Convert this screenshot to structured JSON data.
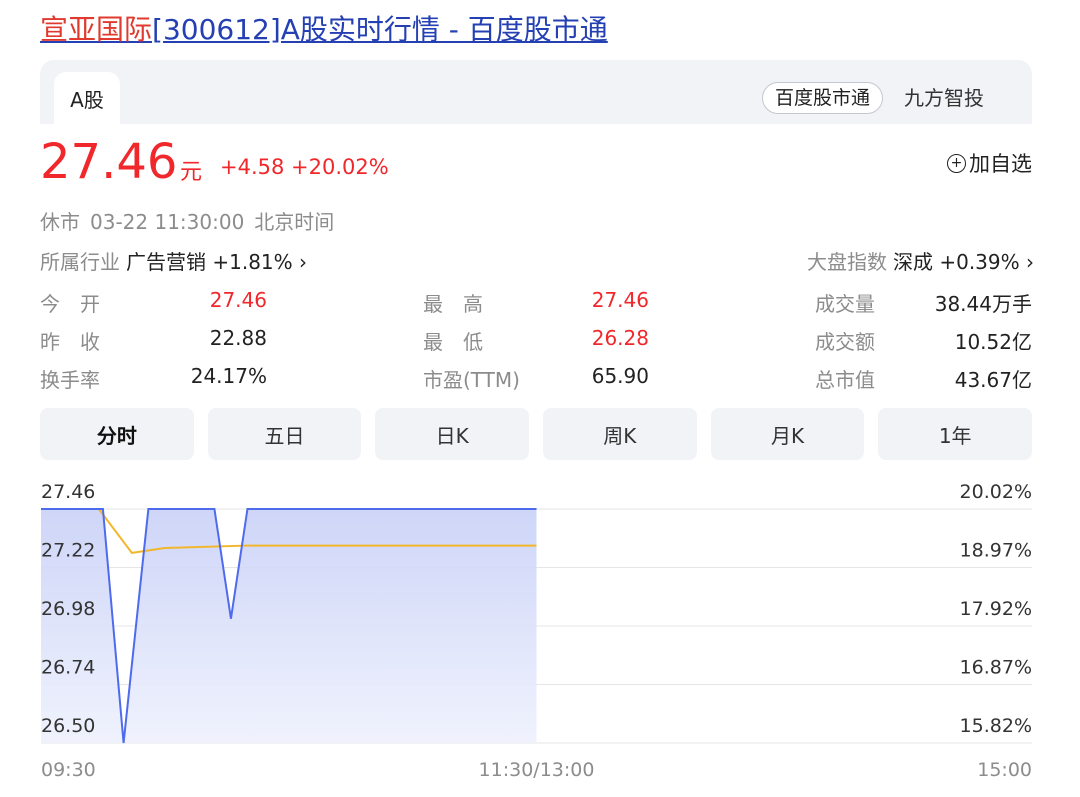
{
  "page": {
    "title_hl": "宣亚国际",
    "title_rest": "[300612]A股实时行情 - 百度股市通"
  },
  "tabs": {
    "active": "A股",
    "source_pill": "百度股市通",
    "source_other": "九方智投"
  },
  "quote": {
    "price": "27.46",
    "unit": "元",
    "change": "+4.58 +20.02%",
    "add_watch": "加自选",
    "status": "休市",
    "datetime": "03-22 11:30:00",
    "timezone": "北京时间",
    "industry_label": "所属行业",
    "industry_name": "广告营销",
    "industry_change": "+1.81% ›",
    "index_label": "大盘指数",
    "index_name": "深成",
    "index_change": "+0.39% ›"
  },
  "stats": [
    [
      {
        "label": "今　开",
        "value": "27.46",
        "color": "red"
      },
      {
        "label": "最　高",
        "value": "27.46",
        "color": "red"
      },
      {
        "label": "成交量",
        "value": "38.44万手",
        "color": "black"
      }
    ],
    [
      {
        "label": "昨　收",
        "value": "22.88",
        "color": "black"
      },
      {
        "label": "最　低",
        "value": "26.28",
        "color": "red"
      },
      {
        "label": "成交额",
        "value": "10.52亿",
        "color": "black"
      }
    ],
    [
      {
        "label": "换手率",
        "value": "24.17%",
        "color": "black"
      },
      {
        "label": "市盈(TTM)",
        "value": "65.90",
        "color": "black"
      },
      {
        "label": "总市值",
        "value": "43.67亿",
        "color": "black"
      }
    ]
  ],
  "timeframes": [
    {
      "label": "分时",
      "active": true
    },
    {
      "label": "五日",
      "active": false
    },
    {
      "label": "日K",
      "active": false
    },
    {
      "label": "周K",
      "active": false
    },
    {
      "label": "月K",
      "active": false
    },
    {
      "label": "1年",
      "active": false
    }
  ],
  "chart_data": {
    "type": "line",
    "y_ticks": [
      "27.46",
      "27.22",
      "26.98",
      "26.74",
      "26.50"
    ],
    "pct_ticks": [
      "20.02%",
      "18.97%",
      "17.92%",
      "16.87%",
      "15.82%"
    ],
    "x_ticks": [
      "09:30",
      "11:30/13:00",
      "15:00"
    ],
    "ylim": [
      26.5,
      27.46
    ],
    "session_minutes": 240,
    "series": [
      {
        "role": "price",
        "color": "#4f6bed",
        "points": [
          [
            0,
            27.46
          ],
          [
            15,
            27.46
          ],
          [
            20,
            26.5
          ],
          [
            26,
            27.46
          ],
          [
            42,
            27.46
          ],
          [
            46,
            27.01
          ],
          [
            50,
            27.46
          ],
          [
            120,
            27.46
          ]
        ]
      },
      {
        "role": "average",
        "color": "#f2b62a",
        "points": [
          [
            0,
            27.46
          ],
          [
            14,
            27.46
          ],
          [
            22,
            27.28
          ],
          [
            30,
            27.3
          ],
          [
            50,
            27.31
          ],
          [
            120,
            27.31
          ]
        ]
      }
    ],
    "colors": {
      "grid": "#e6e6e6",
      "fill_top": "#c9d1f7",
      "fill_bottom": "#eef1fd"
    }
  }
}
